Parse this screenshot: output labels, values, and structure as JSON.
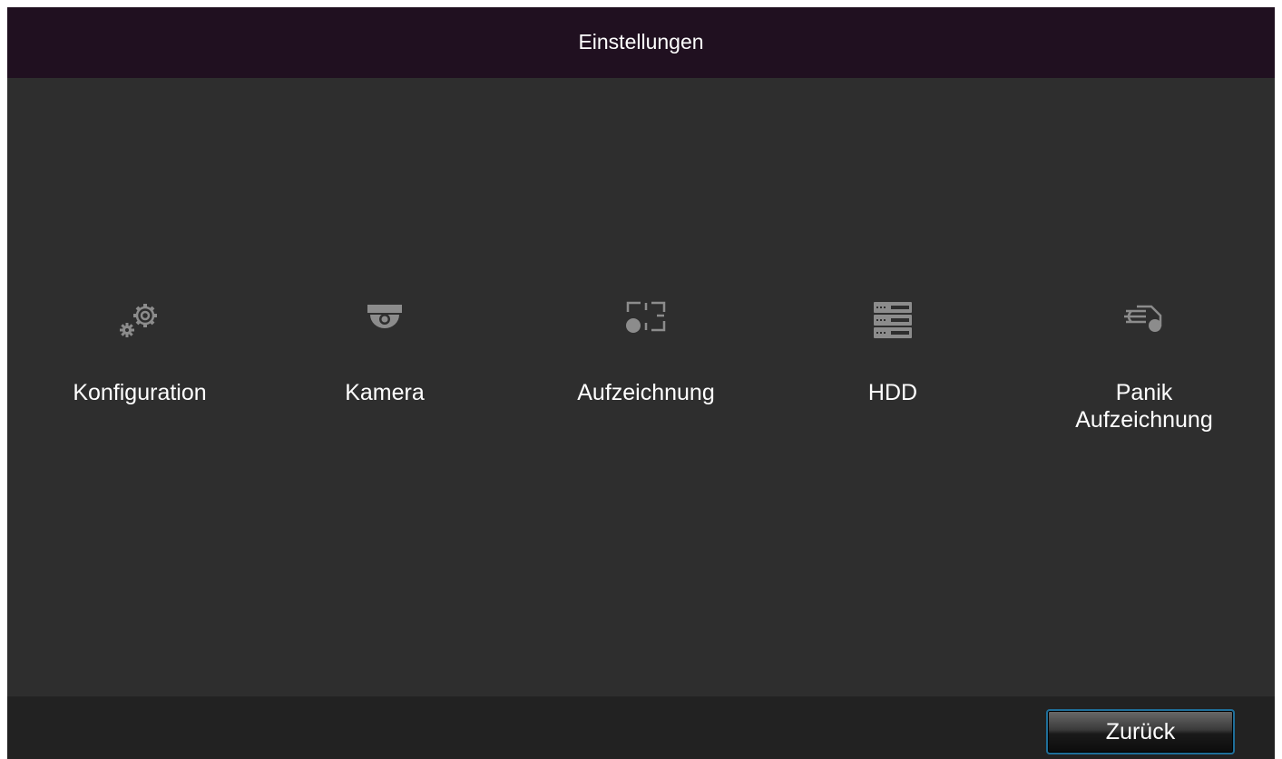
{
  "header": {
    "title": "Einstellungen"
  },
  "menu": {
    "items": [
      {
        "label": "Konfiguration",
        "icon": "gears-icon"
      },
      {
        "label": "Kamera",
        "icon": "dome-camera-icon"
      },
      {
        "label": "Aufzeichnung",
        "icon": "record-icon"
      },
      {
        "label": "HDD",
        "icon": "hdd-icon"
      },
      {
        "label": "Panik\nAufzeichnung",
        "icon": "panic-record-icon"
      }
    ]
  },
  "footer": {
    "back_label": "Zurück"
  },
  "colors": {
    "background": "#2e2e2e",
    "titlebar": "#201020",
    "footer": "#222222",
    "icon": "#8c8c8c",
    "button_border": "#1f6f9a",
    "text": "#ffffff"
  }
}
